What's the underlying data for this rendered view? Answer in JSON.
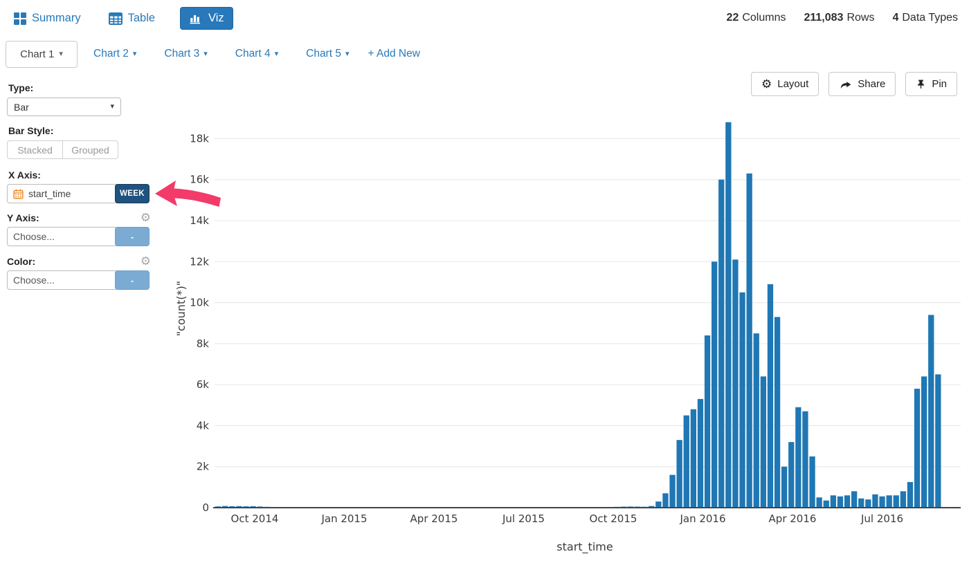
{
  "header": {
    "nav_summary": "Summary",
    "nav_table": "Table",
    "nav_viz": "Viz",
    "stats": [
      {
        "value": "22",
        "label": "Columns"
      },
      {
        "value": "211,083",
        "label": "Rows"
      },
      {
        "value": "4",
        "label": "Data Types"
      }
    ]
  },
  "tabs": {
    "active_label": "Chart 1",
    "others": [
      "Chart 2",
      "Chart 3",
      "Chart 4",
      "Chart 5"
    ],
    "add_new": "+ Add New"
  },
  "toolbar": {
    "layout_label": "Layout",
    "share_label": "Share",
    "pin_label": "Pin"
  },
  "controls": {
    "type_label": "Type:",
    "type_value": "Bar",
    "bar_style_label": "Bar Style:",
    "stacked_label": "Stacked",
    "grouped_label": "Grouped",
    "x_axis_label": "X Axis:",
    "x_axis_value": "start_time",
    "x_axis_badge": "WEEK",
    "y_axis_label": "Y Axis:",
    "y_axis_value": "Choose...",
    "y_axis_badge": "-",
    "color_label": "Color:",
    "color_value": "Choose...",
    "color_badge": "-"
  },
  "colors": {
    "accent_blue": "#2979b8",
    "viz_button_bg": "#2878ba",
    "week_badge_bg": "#20527f",
    "minus_badge_bg": "#7babd3",
    "bar_color": "#1f77b4",
    "annotation_arrow": "#f23b69",
    "calendar_icon": "#f08a24"
  },
  "chart_data": {
    "type": "bar",
    "title": "",
    "xlabel": "start_time",
    "ylabel": "\"count(*)\"",
    "x_unit": "week",
    "x_tick_labels": [
      "Oct 2014",
      "Jan 2015",
      "Apr 2015",
      "Jul 2015",
      "Oct 2015",
      "Jan 2016",
      "Apr 2016",
      "Jul 2016"
    ],
    "y_tick_labels": [
      "0",
      "2k",
      "4k",
      "6k",
      "8k",
      "10k",
      "12k",
      "14k",
      "16k",
      "18k"
    ],
    "ylim": [
      0,
      19700
    ],
    "gridline_every": 2000,
    "legend": null,
    "series": [
      {
        "name": "count(*)",
        "week_start_dates": [
          "2014-08-31",
          "2014-09-07",
          "2014-09-14",
          "2014-09-21",
          "2014-09-28",
          "2014-10-05",
          "2014-10-12",
          "2014-10-19",
          "2014-10-26",
          "2014-11-02",
          "2014-11-09",
          "2014-11-16",
          "2014-11-23",
          "2014-11-30",
          "2014-12-07",
          "2014-12-14",
          "2014-12-21",
          "2014-12-28",
          "2015-01-04",
          "2015-01-11",
          "2015-01-18",
          "2015-01-25",
          "2015-02-01",
          "2015-02-08",
          "2015-02-15",
          "2015-02-22",
          "2015-03-01",
          "2015-03-08",
          "2015-03-15",
          "2015-03-22",
          "2015-03-29",
          "2015-04-05",
          "2015-04-12",
          "2015-04-19",
          "2015-04-26",
          "2015-05-03",
          "2015-05-10",
          "2015-05-17",
          "2015-05-24",
          "2015-05-31",
          "2015-06-07",
          "2015-06-14",
          "2015-06-21",
          "2015-06-28",
          "2015-07-05",
          "2015-07-12",
          "2015-07-19",
          "2015-07-26",
          "2015-08-02",
          "2015-08-09",
          "2015-08-16",
          "2015-08-23",
          "2015-08-30",
          "2015-09-06",
          "2015-09-13",
          "2015-09-20",
          "2015-09-27",
          "2015-10-04",
          "2015-10-11",
          "2015-10-18",
          "2015-10-25",
          "2015-11-01",
          "2015-11-08",
          "2015-11-15",
          "2015-11-22",
          "2015-11-29",
          "2015-12-06",
          "2015-12-13",
          "2015-12-20",
          "2015-12-27",
          "2016-01-03",
          "2016-01-10",
          "2016-01-17",
          "2016-01-24",
          "2016-01-31",
          "2016-02-07",
          "2016-02-14",
          "2016-02-21",
          "2016-02-28",
          "2016-03-06",
          "2016-03-13",
          "2016-03-20",
          "2016-03-27",
          "2016-04-03",
          "2016-04-10",
          "2016-04-17",
          "2016-04-24",
          "2016-05-01",
          "2016-05-08",
          "2016-05-15",
          "2016-05-22",
          "2016-05-29",
          "2016-06-05",
          "2016-06-12",
          "2016-06-19",
          "2016-06-26",
          "2016-07-03",
          "2016-07-10",
          "2016-07-17",
          "2016-07-24",
          "2016-07-31",
          "2016-08-07",
          "2016-08-14",
          "2016-08-21"
        ],
        "values": [
          60,
          80,
          70,
          75,
          65,
          70,
          55,
          40,
          0,
          0,
          0,
          0,
          0,
          0,
          0,
          0,
          0,
          0,
          0,
          0,
          0,
          0,
          0,
          0,
          0,
          0,
          0,
          0,
          0,
          0,
          0,
          0,
          0,
          0,
          0,
          0,
          0,
          0,
          0,
          0,
          0,
          0,
          0,
          0,
          0,
          0,
          0,
          0,
          0,
          0,
          0,
          0,
          0,
          0,
          0,
          0,
          0,
          40,
          50,
          55,
          50,
          45,
          80,
          300,
          700,
          1600,
          3300,
          4500,
          4800,
          5300,
          8400,
          12000,
          16000,
          18800,
          12100,
          10500,
          16300,
          8500,
          6400,
          10900,
          9300,
          2000,
          3200,
          4900,
          4700,
          2500,
          500,
          350,
          600,
          550,
          600,
          800,
          450,
          400,
          650,
          550,
          600,
          600,
          800,
          1250,
          5800,
          6400,
          9400,
          6500
        ]
      }
    ]
  }
}
